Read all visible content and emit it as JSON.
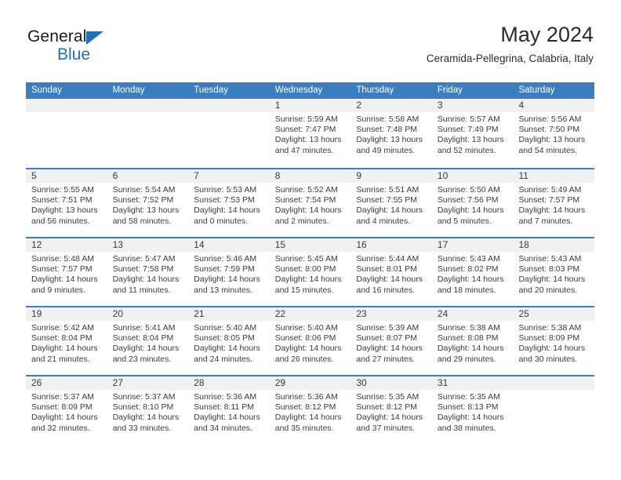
{
  "brand": {
    "name_top": "General",
    "name_bottom": "Blue",
    "accent_color": "#1c71b8",
    "triangle_icon": "brand-triangle-icon"
  },
  "header": {
    "title": "May 2024",
    "subtitle": "Ceramida-Pellegrina, Calabria, Italy"
  },
  "colors": {
    "header_blue": "#3a7ebf",
    "day_strip_grey": "#f0f0f0",
    "text": "#3a3a3a"
  },
  "weekdays": [
    "Sunday",
    "Monday",
    "Tuesday",
    "Wednesday",
    "Thursday",
    "Friday",
    "Saturday"
  ],
  "weeks": [
    [
      {
        "day": "",
        "sunrise": "",
        "sunset": "",
        "daylight1": "",
        "daylight2": ""
      },
      {
        "day": "",
        "sunrise": "",
        "sunset": "",
        "daylight1": "",
        "daylight2": ""
      },
      {
        "day": "",
        "sunrise": "",
        "sunset": "",
        "daylight1": "",
        "daylight2": ""
      },
      {
        "day": "1",
        "sunrise": "Sunrise: 5:59 AM",
        "sunset": "Sunset: 7:47 PM",
        "daylight1": "Daylight: 13 hours",
        "daylight2": "and 47 minutes."
      },
      {
        "day": "2",
        "sunrise": "Sunrise: 5:58 AM",
        "sunset": "Sunset: 7:48 PM",
        "daylight1": "Daylight: 13 hours",
        "daylight2": "and 49 minutes."
      },
      {
        "day": "3",
        "sunrise": "Sunrise: 5:57 AM",
        "sunset": "Sunset: 7:49 PM",
        "daylight1": "Daylight: 13 hours",
        "daylight2": "and 52 minutes."
      },
      {
        "day": "4",
        "sunrise": "Sunrise: 5:56 AM",
        "sunset": "Sunset: 7:50 PM",
        "daylight1": "Daylight: 13 hours",
        "daylight2": "and 54 minutes."
      }
    ],
    [
      {
        "day": "5",
        "sunrise": "Sunrise: 5:55 AM",
        "sunset": "Sunset: 7:51 PM",
        "daylight1": "Daylight: 13 hours",
        "daylight2": "and 56 minutes."
      },
      {
        "day": "6",
        "sunrise": "Sunrise: 5:54 AM",
        "sunset": "Sunset: 7:52 PM",
        "daylight1": "Daylight: 13 hours",
        "daylight2": "and 58 minutes."
      },
      {
        "day": "7",
        "sunrise": "Sunrise: 5:53 AM",
        "sunset": "Sunset: 7:53 PM",
        "daylight1": "Daylight: 14 hours",
        "daylight2": "and 0 minutes."
      },
      {
        "day": "8",
        "sunrise": "Sunrise: 5:52 AM",
        "sunset": "Sunset: 7:54 PM",
        "daylight1": "Daylight: 14 hours",
        "daylight2": "and 2 minutes."
      },
      {
        "day": "9",
        "sunrise": "Sunrise: 5:51 AM",
        "sunset": "Sunset: 7:55 PM",
        "daylight1": "Daylight: 14 hours",
        "daylight2": "and 4 minutes."
      },
      {
        "day": "10",
        "sunrise": "Sunrise: 5:50 AM",
        "sunset": "Sunset: 7:56 PM",
        "daylight1": "Daylight: 14 hours",
        "daylight2": "and 5 minutes."
      },
      {
        "day": "11",
        "sunrise": "Sunrise: 5:49 AM",
        "sunset": "Sunset: 7:57 PM",
        "daylight1": "Daylight: 14 hours",
        "daylight2": "and 7 minutes."
      }
    ],
    [
      {
        "day": "12",
        "sunrise": "Sunrise: 5:48 AM",
        "sunset": "Sunset: 7:57 PM",
        "daylight1": "Daylight: 14 hours",
        "daylight2": "and 9 minutes."
      },
      {
        "day": "13",
        "sunrise": "Sunrise: 5:47 AM",
        "sunset": "Sunset: 7:58 PM",
        "daylight1": "Daylight: 14 hours",
        "daylight2": "and 11 minutes."
      },
      {
        "day": "14",
        "sunrise": "Sunrise: 5:46 AM",
        "sunset": "Sunset: 7:59 PM",
        "daylight1": "Daylight: 14 hours",
        "daylight2": "and 13 minutes."
      },
      {
        "day": "15",
        "sunrise": "Sunrise: 5:45 AM",
        "sunset": "Sunset: 8:00 PM",
        "daylight1": "Daylight: 14 hours",
        "daylight2": "and 15 minutes."
      },
      {
        "day": "16",
        "sunrise": "Sunrise: 5:44 AM",
        "sunset": "Sunset: 8:01 PM",
        "daylight1": "Daylight: 14 hours",
        "daylight2": "and 16 minutes."
      },
      {
        "day": "17",
        "sunrise": "Sunrise: 5:43 AM",
        "sunset": "Sunset: 8:02 PM",
        "daylight1": "Daylight: 14 hours",
        "daylight2": "and 18 minutes."
      },
      {
        "day": "18",
        "sunrise": "Sunrise: 5:43 AM",
        "sunset": "Sunset: 8:03 PM",
        "daylight1": "Daylight: 14 hours",
        "daylight2": "and 20 minutes."
      }
    ],
    [
      {
        "day": "19",
        "sunrise": "Sunrise: 5:42 AM",
        "sunset": "Sunset: 8:04 PM",
        "daylight1": "Daylight: 14 hours",
        "daylight2": "and 21 minutes."
      },
      {
        "day": "20",
        "sunrise": "Sunrise: 5:41 AM",
        "sunset": "Sunset: 8:04 PM",
        "daylight1": "Daylight: 14 hours",
        "daylight2": "and 23 minutes."
      },
      {
        "day": "21",
        "sunrise": "Sunrise: 5:40 AM",
        "sunset": "Sunset: 8:05 PM",
        "daylight1": "Daylight: 14 hours",
        "daylight2": "and 24 minutes."
      },
      {
        "day": "22",
        "sunrise": "Sunrise: 5:40 AM",
        "sunset": "Sunset: 8:06 PM",
        "daylight1": "Daylight: 14 hours",
        "daylight2": "and 26 minutes."
      },
      {
        "day": "23",
        "sunrise": "Sunrise: 5:39 AM",
        "sunset": "Sunset: 8:07 PM",
        "daylight1": "Daylight: 14 hours",
        "daylight2": "and 27 minutes."
      },
      {
        "day": "24",
        "sunrise": "Sunrise: 5:38 AM",
        "sunset": "Sunset: 8:08 PM",
        "daylight1": "Daylight: 14 hours",
        "daylight2": "and 29 minutes."
      },
      {
        "day": "25",
        "sunrise": "Sunrise: 5:38 AM",
        "sunset": "Sunset: 8:09 PM",
        "daylight1": "Daylight: 14 hours",
        "daylight2": "and 30 minutes."
      }
    ],
    [
      {
        "day": "26",
        "sunrise": "Sunrise: 5:37 AM",
        "sunset": "Sunset: 8:09 PM",
        "daylight1": "Daylight: 14 hours",
        "daylight2": "and 32 minutes."
      },
      {
        "day": "27",
        "sunrise": "Sunrise: 5:37 AM",
        "sunset": "Sunset: 8:10 PM",
        "daylight1": "Daylight: 14 hours",
        "daylight2": "and 33 minutes."
      },
      {
        "day": "28",
        "sunrise": "Sunrise: 5:36 AM",
        "sunset": "Sunset: 8:11 PM",
        "daylight1": "Daylight: 14 hours",
        "daylight2": "and 34 minutes."
      },
      {
        "day": "29",
        "sunrise": "Sunrise: 5:36 AM",
        "sunset": "Sunset: 8:12 PM",
        "daylight1": "Daylight: 14 hours",
        "daylight2": "and 35 minutes."
      },
      {
        "day": "30",
        "sunrise": "Sunrise: 5:35 AM",
        "sunset": "Sunset: 8:12 PM",
        "daylight1": "Daylight: 14 hours",
        "daylight2": "and 37 minutes."
      },
      {
        "day": "31",
        "sunrise": "Sunrise: 5:35 AM",
        "sunset": "Sunset: 8:13 PM",
        "daylight1": "Daylight: 14 hours",
        "daylight2": "and 38 minutes."
      },
      {
        "day": "",
        "sunrise": "",
        "sunset": "",
        "daylight1": "",
        "daylight2": ""
      }
    ]
  ]
}
